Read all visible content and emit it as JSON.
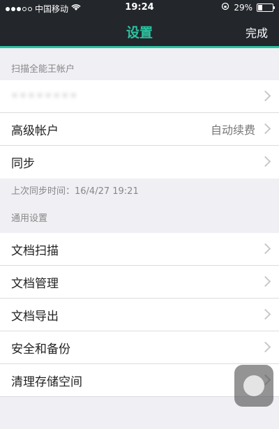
{
  "status": {
    "carrier": "中国移动",
    "time": "19:24",
    "battery_text": "29%",
    "battery_level": 0.29
  },
  "nav": {
    "title": "设置",
    "done_label": "完成"
  },
  "colors": {
    "accent": "#2ac3a0",
    "bar": "#23262b"
  },
  "account_section": {
    "header": "扫描全能王帐户",
    "rows": [
      {
        "label": "••••••••",
        "value": ""
      },
      {
        "label": "高级帐户",
        "value": "自动续费"
      },
      {
        "label": "同步",
        "value": ""
      }
    ],
    "sync_note": "上次同步时间：16/4/27 19:21"
  },
  "general_section": {
    "header": "通用设置",
    "rows": [
      {
        "label": "文档扫描"
      },
      {
        "label": "文档管理"
      },
      {
        "label": "文档导出"
      },
      {
        "label": "安全和备份"
      },
      {
        "label": "清理存储空间"
      }
    ]
  }
}
